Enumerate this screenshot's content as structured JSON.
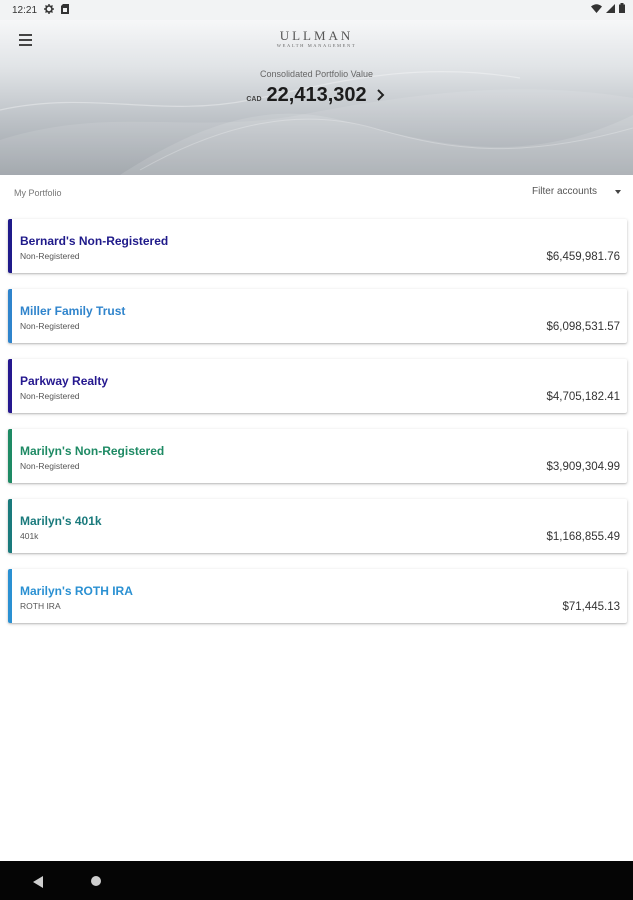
{
  "status_bar": {
    "time": "12:21",
    "left_icons": [
      "settings-gear-icon",
      "sim-card-icon"
    ],
    "right_icons": [
      "wifi-icon",
      "signal-icon",
      "battery-icon"
    ]
  },
  "header": {
    "logo_main": "ULLMAN",
    "logo_sub": "WEALTH MANAGEMENT",
    "cpv_label": "Consolidated Portfolio Value",
    "currency": "CAD",
    "value": "22,413,302"
  },
  "portfolio": {
    "title": "My Portfolio",
    "filter_label": "Filter accounts"
  },
  "accounts": [
    {
      "name": "Bernard's Non-Registered",
      "type": "Non-Registered",
      "value": "$6,459,981.76",
      "color": "#1f1a8a"
    },
    {
      "name": "Miller Family Trust",
      "type": "Non-Registered",
      "value": "$6,098,531.57",
      "color": "#2f84cc"
    },
    {
      "name": "Parkway Realty",
      "type": "Non-Registered",
      "value": "$4,705,182.41",
      "color": "#25188f"
    },
    {
      "name": "Marilyn's Non-Registered",
      "type": "Non-Registered",
      "value": "$3,909,304.99",
      "color": "#1e8a64"
    },
    {
      "name": "Marilyn's 401k",
      "type": "401k",
      "value": "$1,168,855.49",
      "color": "#1a7a7c"
    },
    {
      "name": "Marilyn's ROTH IRA",
      "type": "ROTH IRA",
      "value": "$71,445.13",
      "color": "#2a90d2"
    }
  ],
  "nav_bar": {
    "icons": [
      "back-icon",
      "home-icon"
    ]
  }
}
